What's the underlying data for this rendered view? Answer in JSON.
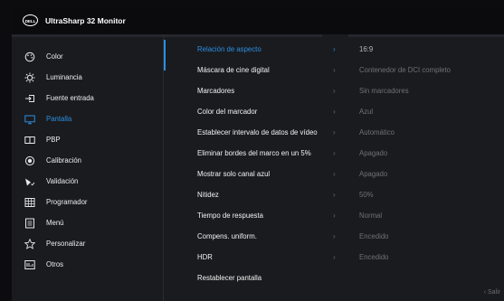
{
  "header": {
    "logo_text": "DELL",
    "title": "UltraSharp 32 Monitor"
  },
  "colors": {
    "accent": "#2a8fe2",
    "text": "#ececec",
    "dim": "#6f7175",
    "panel": "#1a1b1f"
  },
  "sidebar": {
    "items": [
      {
        "label": "Color",
        "icon": "color-palette-icon"
      },
      {
        "label": "Luminancia",
        "icon": "brightness-icon"
      },
      {
        "label": "Fuente entrada",
        "icon": "input-source-icon"
      },
      {
        "label": "Pantalla",
        "icon": "display-icon",
        "active": true
      },
      {
        "label": "PBP",
        "icon": "pbp-icon"
      },
      {
        "label": "Calibración",
        "icon": "calibration-icon"
      },
      {
        "label": "Validación",
        "icon": "validation-icon"
      },
      {
        "label": "Programador",
        "icon": "scheduler-icon"
      },
      {
        "label": "Menú",
        "icon": "menu-icon"
      },
      {
        "label": "Personalizar",
        "icon": "star-icon"
      },
      {
        "label": "Otros",
        "icon": "others-icon"
      }
    ]
  },
  "settings": {
    "rows": [
      {
        "label": "Relación de aspecto",
        "value": "16:9",
        "active": true
      },
      {
        "label": "Máscara de cine digital",
        "value": "Contenedor de DCI completo"
      },
      {
        "label": "Marcadores",
        "value": "Sin marcadores"
      },
      {
        "label": "Color del marcador",
        "value": "Azul"
      },
      {
        "label": "Establecer intervalo de datos de vídeo",
        "value": "Automático"
      },
      {
        "label": "Eliminar bordes del marco en un 5%",
        "value": "Apagado"
      },
      {
        "label": "Mostrar solo canal azul",
        "value": "Apagado"
      },
      {
        "label": "Nitidez",
        "value": "50%"
      },
      {
        "label": "Tiempo de respuesta",
        "value": "Normal"
      },
      {
        "label": "Compens. uniform.",
        "value": "Encedido"
      },
      {
        "label": "HDR",
        "value": "Encedido"
      }
    ],
    "reset_label": "Restablecer pantalla"
  },
  "footer": {
    "exit_label": "Salir",
    "exit_icon": "chevron-left-icon"
  }
}
